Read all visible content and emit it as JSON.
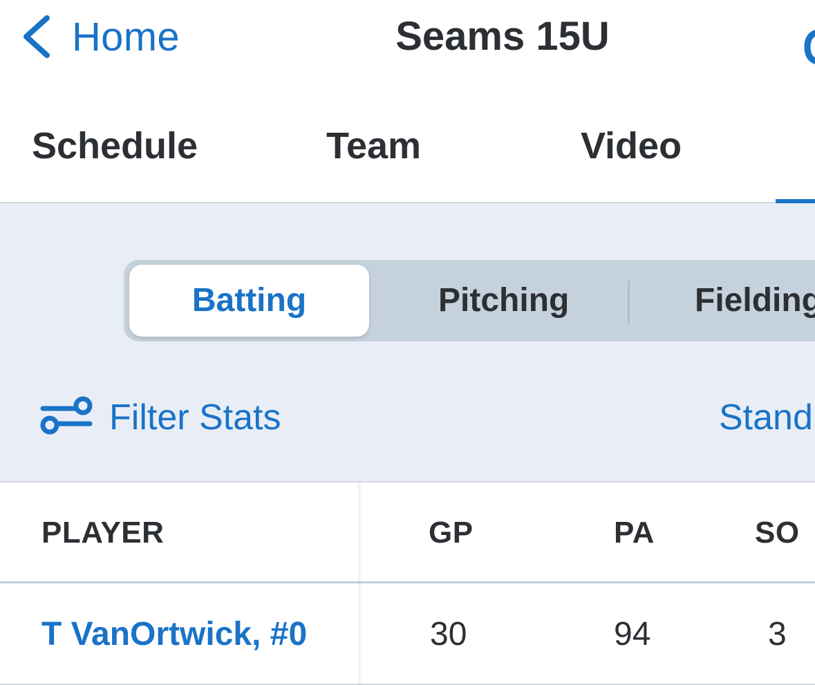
{
  "nav": {
    "back_label": "Home",
    "title": "Seams 15U"
  },
  "tabs": [
    {
      "label": "Schedule"
    },
    {
      "label": "Team"
    },
    {
      "label": "Video"
    }
  ],
  "stats": {
    "segments": [
      {
        "label": "Batting",
        "selected": true
      },
      {
        "label": "Pitching",
        "selected": false
      },
      {
        "label": "Fielding",
        "selected": false
      }
    ],
    "filter_label": "Filter Stats",
    "standings_label": "Stand"
  },
  "table": {
    "columns": [
      "PLAYER",
      "GP",
      "PA",
      "SO"
    ],
    "rows": [
      {
        "player": "T VanOrtwick, #0",
        "gp": "30",
        "pa": "94",
        "so": "3"
      }
    ]
  },
  "colors": {
    "accent": "#1a73c7",
    "text": "#2c2f33",
    "panel_bg": "#e9eef6",
    "segment_bg": "#c6d1de"
  },
  "icons": {
    "back": "chevron-left-icon",
    "filter": "sliders-icon"
  }
}
